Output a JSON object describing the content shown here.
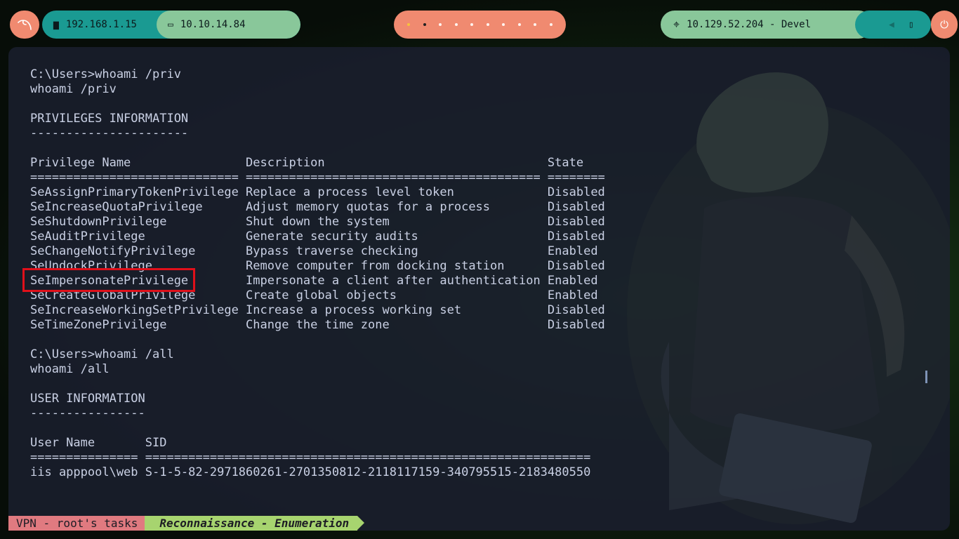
{
  "topbar": {
    "kali_icon": "kali-dragon-icon",
    "net_local": "192.168.1.15",
    "net_vpn": "10.10.14.84",
    "workspaces": {
      "count": 10,
      "active_index": 1
    },
    "target": "10.129.52.204 - Devel",
    "power_icon": "power-icon"
  },
  "terminal": {
    "lines": [
      "C:\\Users>whoami /priv",
      "whoami /priv",
      "",
      "PRIVILEGES INFORMATION",
      "----------------------",
      "",
      "Privilege Name                Description                               State",
      "============================= ========================================= ========",
      "SeAssignPrimaryTokenPrivilege Replace a process level token             Disabled",
      "SeIncreaseQuotaPrivilege      Adjust memory quotas for a process        Disabled",
      "SeShutdownPrivilege           Shut down the system                      Disabled",
      "SeAuditPrivilege              Generate security audits                  Disabled",
      "SeChangeNotifyPrivilege       Bypass traverse checking                  Enabled",
      "SeUndockPrivilege             Remove computer from docking station      Disabled",
      "SeImpersonatePrivilege        Impersonate a client after authentication Enabled",
      "SeCreateGlobalPrivilege       Create global objects                     Enabled",
      "SeIncreaseWorkingSetPrivilege Increase a process working set            Disabled",
      "SeTimeZonePrivilege           Change the time zone                      Disabled",
      "",
      "C:\\Users>whoami /all",
      "whoami /all",
      "",
      "USER INFORMATION",
      "----------------",
      "",
      "User Name       SID",
      "=============== ==============================================================",
      "iis apppool\\web S-1-5-82-2971860261-2701350812-2118117159-340795515-2183480550"
    ]
  },
  "status": {
    "session": "VPN - root's tasks",
    "window": "Reconnaissance - Enumeration"
  }
}
